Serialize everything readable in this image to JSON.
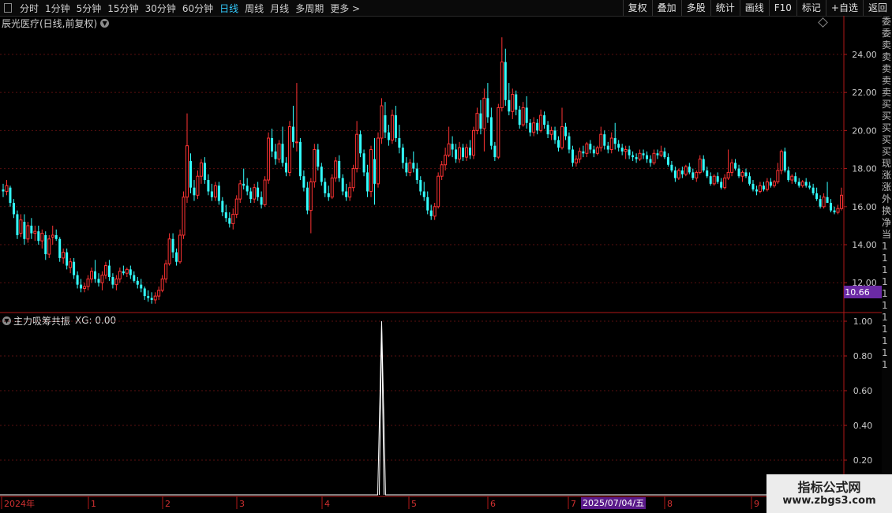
{
  "toolbar": {
    "periods": [
      "分时",
      "1分钟",
      "5分钟",
      "15分钟",
      "30分钟",
      "60分钟",
      "日线",
      "周线",
      "月线",
      "多周期",
      "更多 >"
    ],
    "active_period": "日线",
    "right_buttons": [
      "复权",
      "叠加",
      "多股",
      "统计",
      "画线",
      "F10",
      "标记",
      "+自选",
      "返回"
    ]
  },
  "stock": {
    "title": "辰光医疗(日线,前复权)",
    "last_price_label": "10.66",
    "y_ticks": [
      "24.00",
      "22.00",
      "20.00",
      "18.00",
      "16.00",
      "14.00",
      "12.00"
    ]
  },
  "indicator": {
    "name": "主力吸筹共振",
    "value_text": "XG: 0.00",
    "y_ticks": [
      "1.00",
      "0.80",
      "0.60",
      "0.40",
      "0.20"
    ]
  },
  "x_axis": {
    "labels": [
      "2024年",
      "1",
      "2",
      "3",
      "4",
      "5",
      "6",
      "7",
      "8",
      "9"
    ],
    "cursor_date": "2025/07/04/五"
  },
  "watermark": {
    "line1": "指标公式网",
    "line2": "www.zbgs3.com"
  },
  "right_strip": [
    "委",
    "委",
    "卖",
    "卖",
    "卖",
    "卖",
    "卖",
    "买",
    "买",
    "买",
    "买",
    "买",
    "现",
    "涨",
    "涨",
    "外",
    "换",
    "净",
    "当",
    "1",
    "1",
    "1",
    "1",
    "1",
    "1",
    "1",
    "1",
    "1",
    "1",
    "1"
  ],
  "colors": {
    "up": "#ff3333",
    "down": "#33ffff",
    "axis": "#b01818",
    "grid": "#5a0f0f",
    "active": "#33ccff",
    "price_tag": "#6b2aa5"
  },
  "chart_data": {
    "type": "candlestick",
    "price_ylim": [
      10.6,
      25.2
    ],
    "signal_spike": {
      "index": 107,
      "value": 1.0
    },
    "indicator_ylim": [
      0,
      1.05
    ],
    "candles": [
      [
        16.9,
        17.2,
        16.5,
        16.8
      ],
      [
        16.8,
        17.4,
        16.6,
        17.1
      ],
      [
        17.0,
        17.1,
        16.0,
        16.2
      ],
      [
        16.2,
        16.4,
        15.4,
        15.6
      ],
      [
        15.6,
        15.8,
        14.3,
        14.5
      ],
      [
        14.6,
        15.6,
        14.4,
        15.3
      ],
      [
        15.2,
        15.6,
        14.0,
        14.3
      ],
      [
        14.3,
        15.2,
        14.1,
        15.0
      ],
      [
        15.0,
        15.4,
        14.3,
        14.6
      ],
      [
        14.6,
        15.0,
        14.2,
        14.7
      ],
      [
        14.7,
        15.0,
        14.0,
        14.2
      ],
      [
        14.2,
        14.8,
        13.8,
        14.6
      ],
      [
        14.5,
        14.7,
        13.2,
        13.5
      ],
      [
        13.5,
        14.5,
        13.3,
        14.3
      ],
      [
        14.4,
        15.0,
        14.0,
        14.5
      ],
      [
        14.5,
        14.8,
        14.2,
        14.3
      ],
      [
        14.3,
        14.4,
        13.1,
        13.3
      ],
      [
        13.3,
        13.8,
        13.0,
        13.6
      ],
      [
        13.6,
        13.8,
        12.7,
        12.9
      ],
      [
        12.8,
        13.3,
        12.5,
        13.1
      ],
      [
        13.1,
        13.3,
        12.2,
        12.4
      ],
      [
        12.4,
        12.6,
        11.7,
        11.9
      ],
      [
        11.9,
        12.2,
        11.5,
        11.7
      ],
      [
        11.7,
        12.0,
        11.5,
        11.8
      ],
      [
        11.8,
        12.4,
        11.6,
        12.2
      ],
      [
        12.2,
        12.8,
        12.0,
        12.6
      ],
      [
        12.6,
        13.2,
        12.0,
        12.2
      ],
      [
        12.2,
        12.5,
        11.8,
        12.0
      ],
      [
        12.0,
        12.6,
        11.6,
        12.4
      ],
      [
        12.4,
        13.1,
        12.2,
        12.9
      ],
      [
        12.9,
        13.2,
        12.1,
        12.3
      ],
      [
        12.3,
        12.5,
        11.7,
        11.9
      ],
      [
        11.9,
        12.4,
        11.6,
        12.2
      ],
      [
        12.2,
        12.8,
        12.0,
        12.6
      ],
      [
        12.6,
        12.9,
        12.4,
        12.5
      ],
      [
        12.5,
        12.8,
        12.3,
        12.7
      ],
      [
        12.7,
        12.9,
        12.2,
        12.4
      ],
      [
        12.4,
        12.6,
        12.0,
        12.1
      ],
      [
        12.1,
        12.3,
        11.7,
        11.9
      ],
      [
        11.9,
        12.2,
        11.5,
        11.7
      ],
      [
        11.7,
        11.8,
        11.1,
        11.3
      ],
      [
        11.3,
        11.6,
        11.0,
        11.2
      ],
      [
        11.2,
        11.5,
        10.9,
        11.1
      ],
      [
        11.1,
        11.5,
        10.9,
        11.3
      ],
      [
        11.3,
        11.8,
        11.1,
        11.6
      ],
      [
        11.6,
        12.4,
        11.5,
        12.2
      ],
      [
        12.2,
        13.2,
        12.0,
        13.0
      ],
      [
        13.0,
        14.6,
        12.9,
        14.3
      ],
      [
        14.3,
        14.6,
        13.3,
        13.6
      ],
      [
        13.6,
        13.8,
        12.9,
        13.1
      ],
      [
        13.1,
        14.8,
        13.0,
        14.5
      ],
      [
        14.5,
        16.8,
        14.3,
        16.5
      ],
      [
        16.5,
        20.9,
        16.2,
        19.2
      ],
      [
        18.4,
        18.8,
        16.7,
        17.0
      ],
      [
        17.0,
        17.4,
        16.3,
        16.6
      ],
      [
        16.6,
        17.9,
        16.4,
        17.6
      ],
      [
        17.6,
        18.5,
        17.2,
        18.3
      ],
      [
        18.3,
        18.6,
        17.2,
        17.4
      ],
      [
        17.4,
        17.7,
        16.6,
        16.8
      ],
      [
        16.8,
        17.2,
        16.3,
        16.5
      ],
      [
        16.5,
        17.3,
        16.3,
        17.1
      ],
      [
        17.1,
        17.3,
        16.1,
        16.3
      ],
      [
        16.3,
        16.5,
        15.5,
        15.7
      ],
      [
        15.7,
        16.1,
        15.2,
        15.4
      ],
      [
        15.4,
        15.7,
        14.9,
        15.1
      ],
      [
        15.1,
        15.9,
        14.8,
        15.6
      ],
      [
        15.6,
        16.6,
        15.4,
        16.4
      ],
      [
        16.4,
        17.4,
        16.2,
        17.2
      ],
      [
        17.2,
        18.0,
        16.9,
        17.1
      ],
      [
        17.1,
        17.5,
        16.6,
        16.8
      ],
      [
        16.8,
        17.0,
        16.2,
        16.4
      ],
      [
        16.4,
        17.2,
        16.2,
        17.0
      ],
      [
        17.0,
        17.3,
        16.3,
        16.5
      ],
      [
        16.5,
        16.8,
        15.9,
        16.1
      ],
      [
        16.1,
        17.6,
        16.0,
        17.4
      ],
      [
        17.4,
        19.9,
        17.2,
        19.6
      ],
      [
        19.6,
        20.1,
        18.6,
        18.9
      ],
      [
        18.9,
        19.3,
        18.2,
        18.5
      ],
      [
        18.5,
        19.5,
        18.3,
        19.3
      ],
      [
        19.3,
        20.2,
        18.1,
        18.3
      ],
      [
        18.3,
        18.6,
        17.6,
        17.8
      ],
      [
        17.8,
        20.5,
        17.6,
        20.2
      ],
      [
        20.2,
        21.3,
        19.1,
        19.4
      ],
      [
        19.4,
        22.5,
        18.9,
        19.4
      ],
      [
        19.4,
        19.6,
        17.4,
        17.6
      ],
      [
        17.6,
        17.9,
        16.8,
        17.0
      ],
      [
        17.0,
        17.3,
        15.6,
        15.8
      ],
      [
        15.8,
        17.5,
        14.6,
        17.3
      ],
      [
        17.3,
        19.3,
        17.0,
        19.0
      ],
      [
        19.0,
        19.3,
        17.9,
        18.1
      ],
      [
        18.1,
        18.3,
        17.1,
        17.3
      ],
      [
        17.3,
        17.5,
        16.5,
        16.7
      ],
      [
        16.7,
        17.1,
        16.3,
        16.5
      ],
      [
        16.5,
        17.7,
        16.4,
        17.5
      ],
      [
        17.5,
        18.6,
        17.3,
        18.4
      ],
      [
        18.4,
        18.7,
        17.3,
        17.5
      ],
      [
        17.5,
        17.7,
        16.6,
        16.8
      ],
      [
        16.8,
        17.2,
        16.3,
        16.5
      ],
      [
        16.5,
        17.3,
        16.3,
        17.0
      ],
      [
        17.0,
        18.2,
        16.8,
        18.0
      ],
      [
        18.0,
        20.5,
        17.8,
        19.8
      ],
      [
        19.8,
        20.0,
        18.6,
        18.8
      ],
      [
        18.8,
        19.0,
        17.6,
        17.8
      ],
      [
        17.8,
        18.2,
        16.5,
        16.8
      ],
      [
        16.8,
        19.2,
        16.5,
        19.0
      ],
      [
        18.5,
        19.6,
        16.1,
        17.2
      ],
      [
        17.2,
        19.9,
        17.0,
        19.6
      ],
      [
        19.6,
        21.7,
        19.3,
        21.3
      ],
      [
        20.8,
        21.5,
        19.6,
        19.9
      ],
      [
        19.9,
        20.3,
        19.2,
        19.5
      ],
      [
        19.5,
        21.1,
        19.3,
        20.8
      ],
      [
        20.8,
        21.3,
        19.4,
        19.6
      ],
      [
        19.6,
        20.3,
        18.8,
        19.1
      ],
      [
        19.1,
        19.3,
        18.0,
        18.3
      ],
      [
        18.3,
        18.6,
        17.6,
        17.8
      ],
      [
        17.8,
        18.5,
        17.6,
        18.3
      ],
      [
        18.3,
        18.9,
        17.8,
        18.0
      ],
      [
        18.0,
        18.3,
        17.2,
        17.4
      ],
      [
        17.4,
        17.6,
        16.6,
        16.8
      ],
      [
        16.8,
        17.3,
        16.3,
        16.5
      ],
      [
        16.5,
        16.8,
        15.6,
        15.8
      ],
      [
        15.8,
        16.1,
        15.3,
        15.5
      ],
      [
        15.5,
        16.2,
        15.3,
        16.0
      ],
      [
        16.0,
        17.8,
        15.9,
        17.6
      ],
      [
        17.6,
        18.4,
        17.4,
        18.2
      ],
      [
        18.2,
        19.1,
        17.9,
        18.7
      ],
      [
        18.7,
        20.2,
        18.6,
        19.3
      ],
      [
        19.3,
        19.7,
        18.6,
        19.0
      ],
      [
        19.0,
        19.3,
        18.3,
        18.5
      ],
      [
        18.5,
        19.4,
        18.3,
        19.1
      ],
      [
        19.1,
        19.3,
        18.4,
        18.6
      ],
      [
        18.6,
        19.3,
        18.4,
        19.1
      ],
      [
        19.1,
        19.5,
        18.5,
        18.7
      ],
      [
        18.7,
        20.2,
        18.5,
        20.0
      ],
      [
        20.0,
        21.2,
        19.8,
        20.9
      ],
      [
        20.9,
        21.6,
        19.8,
        20.1
      ],
      [
        20.1,
        22.2,
        18.9,
        21.7
      ],
      [
        21.7,
        22.5,
        20.4,
        20.7
      ],
      [
        20.7,
        21.2,
        19.0,
        19.2
      ],
      [
        19.2,
        19.4,
        18.4,
        18.6
      ],
      [
        18.6,
        21.4,
        18.5,
        21.2
      ],
      [
        21.2,
        24.9,
        21.0,
        23.6
      ],
      [
        23.6,
        24.3,
        21.3,
        21.6
      ],
      [
        21.6,
        22.5,
        20.8,
        21.0
      ],
      [
        21.0,
        22.2,
        20.6,
        21.9
      ],
      [
        21.9,
        22.1,
        20.8,
        21.1
      ],
      [
        21.1,
        21.3,
        20.1,
        20.3
      ],
      [
        20.3,
        21.5,
        20.2,
        21.2
      ],
      [
        21.2,
        21.8,
        20.1,
        20.4
      ],
      [
        20.4,
        20.6,
        19.7,
        19.9
      ],
      [
        19.9,
        20.7,
        19.7,
        20.4
      ],
      [
        20.4,
        20.6,
        19.8,
        20.0
      ],
      [
        20.0,
        21.1,
        19.9,
        20.8
      ],
      [
        20.8,
        21.0,
        20.1,
        20.3
      ],
      [
        20.3,
        20.5,
        19.6,
        19.8
      ],
      [
        19.8,
        20.2,
        19.5,
        20.0
      ],
      [
        20.0,
        20.2,
        19.3,
        19.5
      ],
      [
        19.5,
        19.7,
        18.9,
        19.1
      ],
      [
        19.1,
        21.2,
        19.0,
        20.2
      ],
      [
        20.2,
        20.4,
        19.5,
        19.7
      ],
      [
        19.7,
        19.9,
        18.8,
        19.0
      ],
      [
        19.0,
        19.2,
        18.1,
        18.3
      ],
      [
        18.3,
        18.7,
        18.1,
        18.5
      ],
      [
        18.5,
        19.1,
        18.3,
        18.9
      ],
      [
        18.9,
        19.2,
        18.6,
        18.8
      ],
      [
        18.8,
        19.4,
        18.6,
        19.3
      ],
      [
        19.3,
        19.5,
        18.8,
        19.0
      ],
      [
        19.0,
        19.2,
        18.6,
        18.8
      ],
      [
        18.8,
        19.2,
        18.7,
        19.1
      ],
      [
        19.1,
        20.2,
        18.9,
        19.8
      ],
      [
        19.8,
        20.0,
        19.0,
        19.2
      ],
      [
        19.2,
        19.4,
        18.8,
        19.0
      ],
      [
        19.0,
        19.9,
        18.8,
        19.6
      ],
      [
        19.6,
        20.4,
        19.0,
        19.3
      ],
      [
        19.3,
        19.5,
        18.9,
        19.1
      ],
      [
        19.1,
        19.3,
        18.7,
        18.9
      ],
      [
        18.9,
        19.2,
        18.5,
        19.0
      ],
      [
        19.0,
        19.2,
        18.5,
        18.7
      ],
      [
        18.7,
        18.9,
        18.4,
        18.6
      ],
      [
        18.6,
        18.8,
        18.3,
        18.5
      ],
      [
        18.5,
        19.0,
        18.4,
        18.8
      ],
      [
        18.8,
        19.0,
        18.5,
        18.7
      ],
      [
        18.7,
        18.9,
        18.3,
        18.5
      ],
      [
        18.5,
        18.7,
        18.1,
        18.3
      ],
      [
        18.3,
        19.0,
        18.2,
        18.8
      ],
      [
        18.8,
        19.0,
        18.5,
        18.7
      ],
      [
        18.7,
        19.2,
        18.6,
        18.9
      ],
      [
        18.9,
        19.1,
        18.5,
        18.6
      ],
      [
        18.6,
        18.8,
        18.1,
        18.2
      ],
      [
        18.2,
        18.4,
        17.8,
        17.9
      ],
      [
        17.9,
        18.1,
        17.3,
        17.5
      ],
      [
        17.5,
        18.0,
        17.4,
        17.9
      ],
      [
        17.9,
        18.1,
        17.5,
        17.7
      ],
      [
        17.7,
        18.2,
        17.6,
        18.1
      ],
      [
        18.1,
        18.3,
        17.7,
        17.8
      ],
      [
        17.8,
        18.0,
        17.4,
        17.5
      ],
      [
        17.5,
        17.9,
        17.3,
        17.8
      ],
      [
        17.8,
        18.7,
        17.7,
        18.5
      ],
      [
        18.5,
        18.7,
        17.8,
        17.9
      ],
      [
        17.9,
        18.1,
        17.5,
        17.6
      ],
      [
        17.6,
        17.8,
        17.1,
        17.2
      ],
      [
        17.2,
        17.7,
        17.1,
        17.6
      ],
      [
        17.6,
        17.8,
        17.2,
        17.3
      ],
      [
        17.3,
        17.5,
        16.9,
        17.0
      ],
      [
        17.0,
        17.7,
        16.9,
        17.5
      ],
      [
        17.5,
        19.0,
        17.4,
        17.8
      ],
      [
        17.8,
        18.5,
        17.6,
        18.3
      ],
      [
        18.3,
        18.5,
        17.9,
        18.0
      ],
      [
        18.0,
        18.2,
        17.5,
        17.6
      ],
      [
        17.6,
        17.9,
        17.3,
        17.8
      ],
      [
        17.8,
        18.0,
        17.5,
        17.6
      ],
      [
        17.6,
        17.8,
        17.1,
        17.2
      ],
      [
        17.2,
        17.4,
        16.8,
        16.9
      ],
      [
        16.9,
        17.1,
        16.6,
        16.8
      ],
      [
        16.8,
        17.3,
        16.7,
        17.1
      ],
      [
        17.1,
        17.3,
        16.8,
        16.9
      ],
      [
        16.9,
        17.5,
        16.8,
        17.3
      ],
      [
        17.3,
        17.5,
        17.0,
        17.1
      ],
      [
        17.1,
        17.4,
        17.0,
        17.3
      ],
      [
        17.3,
        18.3,
        17.2,
        17.9
      ],
      [
        17.9,
        19.0,
        17.7,
        18.9
      ],
      [
        18.9,
        19.1,
        17.8,
        17.9
      ],
      [
        17.9,
        18.1,
        17.3,
        17.4
      ],
      [
        17.4,
        17.7,
        17.2,
        17.6
      ],
      [
        17.6,
        17.8,
        17.2,
        17.3
      ],
      [
        17.3,
        17.5,
        17.0,
        17.1
      ],
      [
        17.1,
        17.4,
        17.0,
        17.3
      ],
      [
        17.3,
        17.5,
        17.0,
        17.1
      ],
      [
        17.1,
        17.3,
        16.9,
        17.0
      ],
      [
        17.0,
        17.2,
        16.6,
        16.7
      ],
      [
        16.7,
        17.0,
        16.3,
        16.4
      ],
      [
        16.4,
        16.6,
        15.9,
        16.0
      ],
      [
        16.0,
        16.7,
        15.9,
        16.5
      ],
      [
        16.5,
        17.3,
        16.4,
        16.2
      ],
      [
        16.2,
        16.4,
        15.7,
        15.8
      ],
      [
        15.8,
        16.0,
        15.6,
        15.7
      ],
      [
        15.7,
        16.1,
        15.6,
        15.9
      ],
      [
        15.9,
        17.0,
        15.8,
        16.6
      ]
    ]
  }
}
